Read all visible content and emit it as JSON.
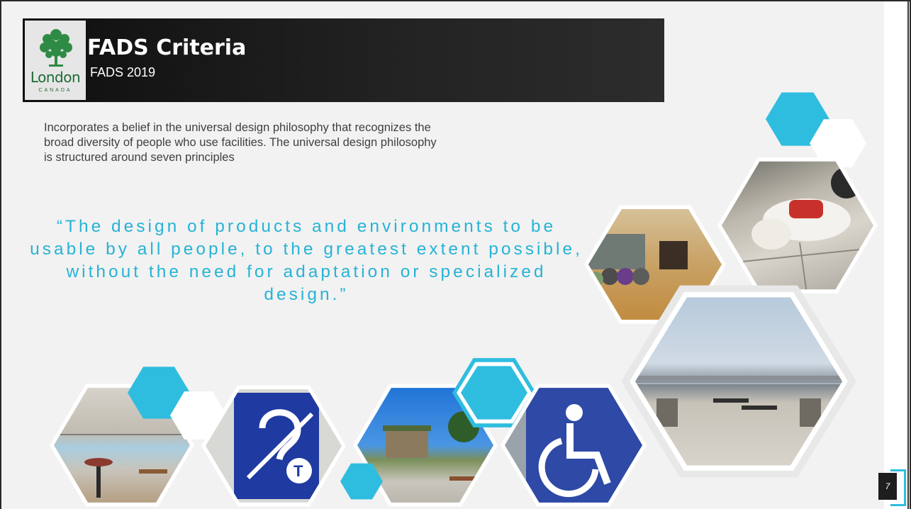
{
  "slide": {
    "title": "FADS Criteria",
    "subtitle": "FADS 2019",
    "logo": {
      "name": "London",
      "sub": "CANADA",
      "icon": "tree-icon"
    },
    "intro": "Incorporates a belief in the universal design philosophy that recognizes the broad diversity of people who use facilities. The universal design philosophy is structured around seven principles",
    "quote": "“The design of products and environments to be usable by all people, to the greatest extent possible, without the need for adaptation or specialized design.”",
    "page_number": "7"
  },
  "colors": {
    "accent": "#2fbddf",
    "title_bar": "#1a1a1a",
    "quote": "#27b3d6",
    "logo_green": "#1d6a34"
  },
  "photos": [
    {
      "name": "photo-service-dog",
      "icon": "service-dog-photo"
    },
    {
      "name": "photo-fitness-room",
      "icon": "fitness-room-photo"
    },
    {
      "name": "photo-rooftop-terrace",
      "icon": "rooftop-terrace-photo"
    },
    {
      "name": "photo-arena-lounge",
      "icon": "arena-lounge-photo"
    },
    {
      "name": "photo-hearing-loop-sign",
      "icon": "hearing-loop-icon"
    },
    {
      "name": "photo-park-washroom",
      "icon": "park-building-photo"
    },
    {
      "name": "photo-accessibility-sign",
      "icon": "wheelchair-icon"
    }
  ]
}
